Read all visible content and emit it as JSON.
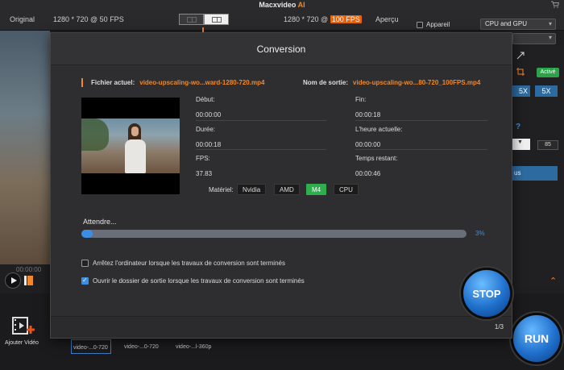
{
  "titlebar": {
    "app_name": "Macxvideo",
    "app_suffix": "AI"
  },
  "toolbar": {
    "original_label": "Original",
    "input_resolution": "1280 * 720 @ 50 FPS",
    "output_resolution_prefix": "1280 * 720 @",
    "output_fps": "100 FPS",
    "apercu_label": "Aperçu"
  },
  "right_panel": {
    "appareil_label": "Appareil",
    "gpu_select_value": "CPU and GPU",
    "active_badge": "Activé",
    "scale_a": "5X",
    "scale_b": "5X",
    "help": "?",
    "value_85": "85",
    "button_partial": "us"
  },
  "background": {
    "timecode": "00:00:00",
    "add_video_label": "Ajouter Vidéo",
    "thumbnails": [
      "video-...0-720",
      "video-...0-720",
      "video-...l-360p"
    ]
  },
  "modal": {
    "title": "Conversion",
    "current_file_label": "Fichier actuel:",
    "current_file_name": "video-upscaling-wo...ward-1280-720.mp4",
    "output_label": "Nom de sortie:",
    "output_file_name": "video-upscaling-wo...80-720_100FPS.mp4",
    "stats": {
      "debut_label": "Début:",
      "debut_value": "00:00:00",
      "fin_label": "Fin:",
      "fin_value": "00:00:18",
      "duree_label": "Durée:",
      "duree_value": "00:00:18",
      "heure_label": "L'heure actuelle:",
      "heure_value": "00:00:00",
      "fps_label": "FPS:",
      "fps_value": "37.83",
      "restant_label": "Temps restant:",
      "restant_value": "00:00:46"
    },
    "materiel_label": "Matériel:",
    "hardware": [
      "Nvidia",
      "AMD",
      "M4",
      "CPU"
    ],
    "hardware_selected": "M4",
    "status": "Attendre...",
    "progress_percent": 3,
    "progress_text": "3%",
    "option_shutdown": "Arrêtez l'ordinateur lorsque les travaux de conversion sont terminés",
    "option_shutdown_checked": false,
    "option_open_folder": "Ouvrir le dossier de sortie lorsque les travaux de conversion sont terminés",
    "option_open_folder_checked": true,
    "page_indicator": "1/3",
    "stop_label": "STOP"
  },
  "run_label": "RUN",
  "colors": {
    "accent_orange": "#f0872a",
    "accent_blue": "#3a8ee6",
    "selected_green": "#2fae4e"
  }
}
